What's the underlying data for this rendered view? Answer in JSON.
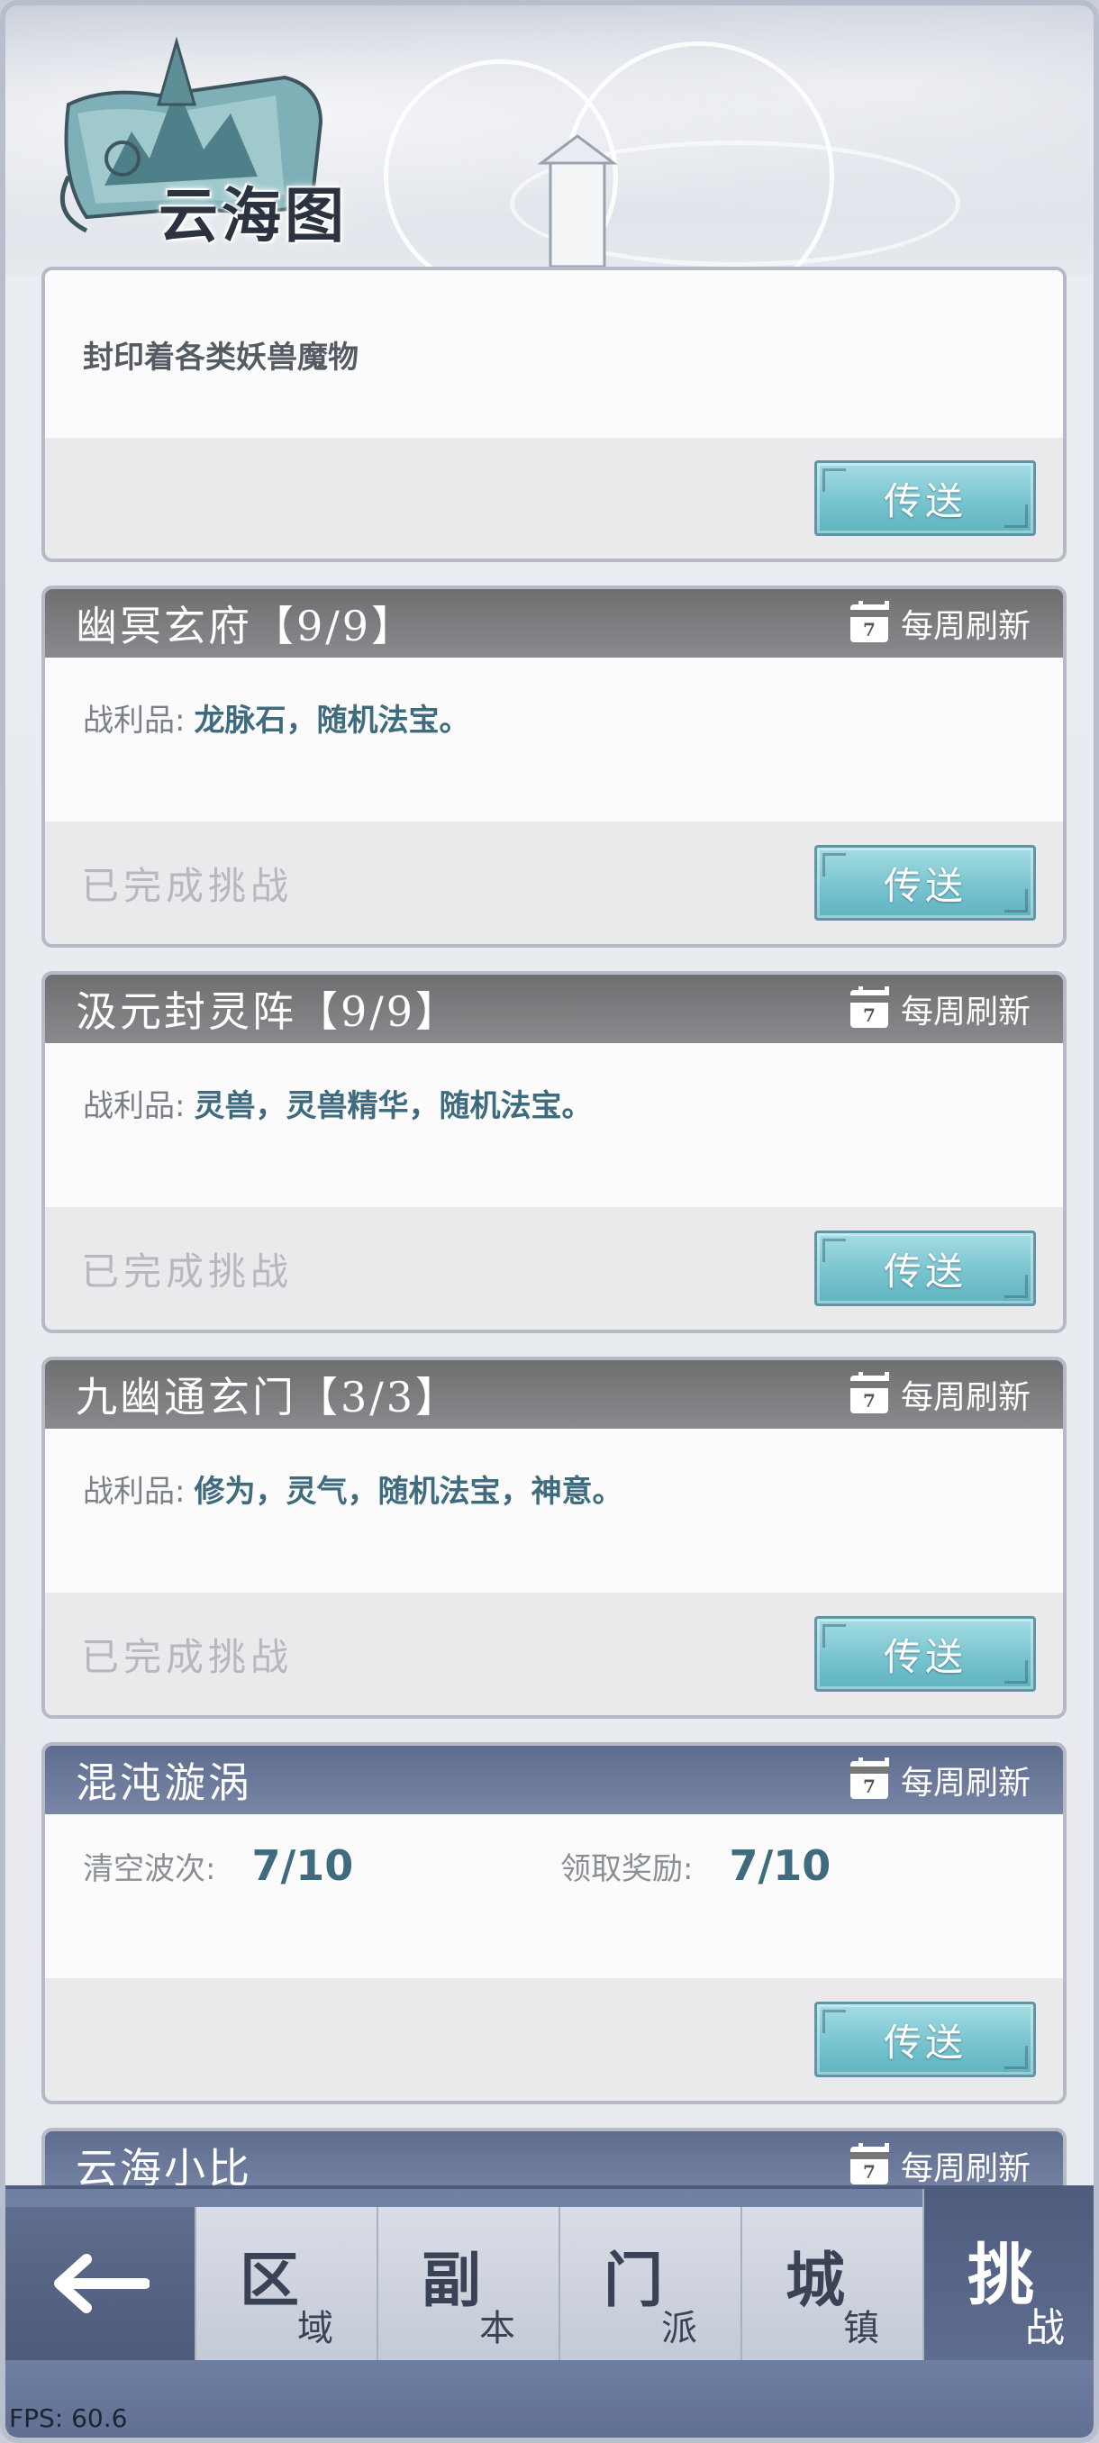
{
  "header": {
    "title": "云海图"
  },
  "intro": {
    "description": "封印着各类妖兽魔物",
    "send_label": "传送"
  },
  "cards": [
    {
      "title": "幽冥玄府【9/9】",
      "refresh": "每周刷新",
      "calendar_day": "7",
      "loot_label": "战利品:",
      "loot_value": "龙脉石，随机法宝。",
      "status": "已完成挑战",
      "send_label": "传送"
    },
    {
      "title": "汲元封灵阵【9/9】",
      "refresh": "每周刷新",
      "calendar_day": "7",
      "loot_label": "战利品:",
      "loot_value": "灵兽，灵兽精华，随机法宝。",
      "status": "已完成挑战",
      "send_label": "传送"
    },
    {
      "title": "九幽通玄门【3/3】",
      "refresh": "每周刷新",
      "calendar_day": "7",
      "loot_label": "战利品:",
      "loot_value": "修为，灵气，随机法宝，神意。",
      "status": "已完成挑战",
      "send_label": "传送"
    },
    {
      "title": "混沌漩涡",
      "refresh": "每周刷新",
      "calendar_day": "7",
      "clear_label": "清空波次:",
      "clear_value": "7/10",
      "reward_label": "领取奖励:",
      "reward_value": "7/10",
      "send_label": "传送"
    },
    {
      "title": "云海小比",
      "refresh": "每周刷新",
      "calendar_day": "7"
    }
  ],
  "nav": {
    "back_icon": "arrow-left-icon",
    "items": [
      {
        "big": "区",
        "small": "域"
      },
      {
        "big": "副",
        "small": "本"
      },
      {
        "big": "门",
        "small": "派"
      },
      {
        "big": "城",
        "small": "镇"
      },
      {
        "big": "挑",
        "small": "战",
        "active": true
      }
    ]
  },
  "fps": "FPS: 60.6"
}
